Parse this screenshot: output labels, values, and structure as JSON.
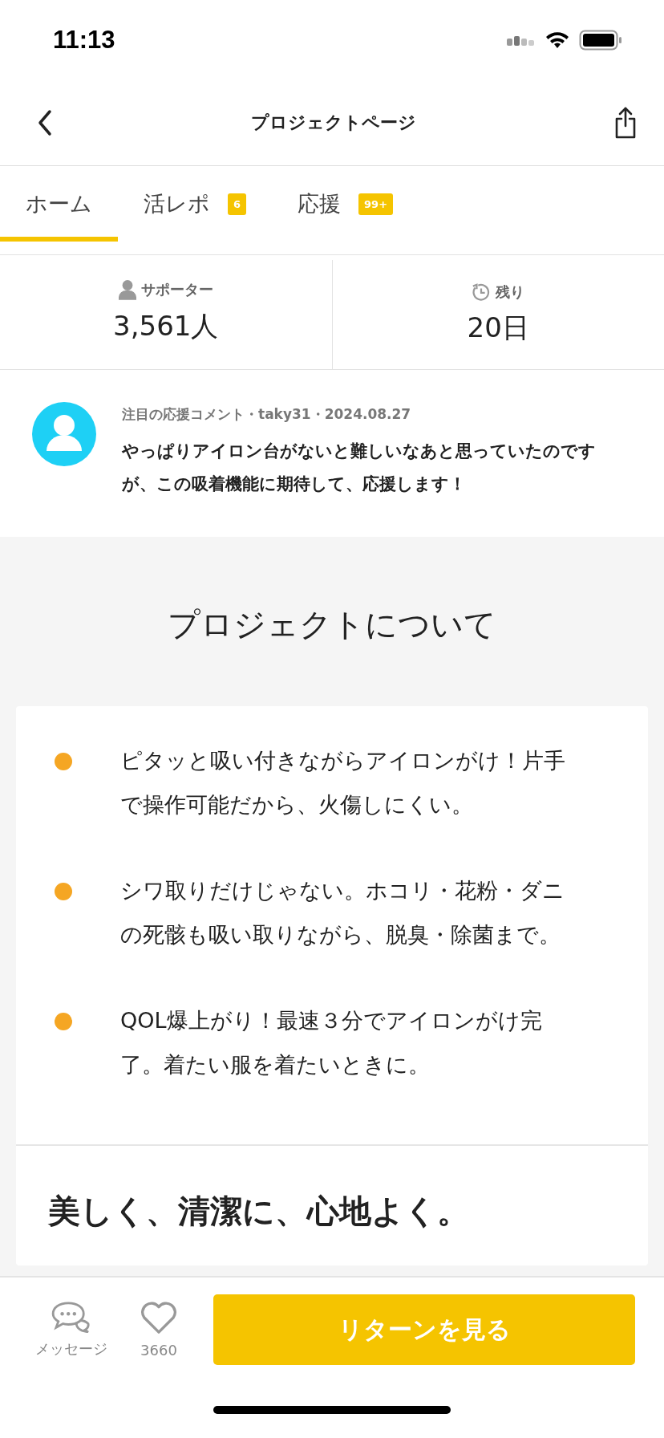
{
  "status_bar": {
    "time": "11:13"
  },
  "nav": {
    "title": "プロジェクトページ"
  },
  "tabs": [
    {
      "label": "ホーム",
      "selected": true
    },
    {
      "label": "活レポ",
      "selected": false,
      "badge": "6"
    },
    {
      "label": "応援",
      "selected": false,
      "badge": "99+"
    }
  ],
  "stats": [
    {
      "kind": "supporters",
      "label": "サポーター",
      "value": "3,561人"
    },
    {
      "kind": "remaining",
      "label": "残り",
      "value": "20日"
    }
  ],
  "featured_comment": {
    "meta": "注目の応援コメント・taky31・2024.08.27",
    "text": "やっぱりアイロン台がないと難しいなあと思っていたのですが、この吸着機能に期待して、応援します！"
  },
  "about": {
    "heading": "プロジェクトについて",
    "points": [
      "ピタッと吸い付きながらアイロンがけ！片手で操作可能だから、火傷しにくい。",
      "シワ取りだけじゃない。ホコリ・花粉・ダニの死骸も吸い取りながら、脱臭・除菌まで。",
      "QOL爆上がり！最速３分でアイロンがけ完了。着たい服を着たいときに。"
    ],
    "subheading": "美しく、清潔に、心地よく。"
  },
  "bottom_bar": {
    "message_label": "メッセージ",
    "like_count": "3660",
    "button": "リターンを見る"
  }
}
